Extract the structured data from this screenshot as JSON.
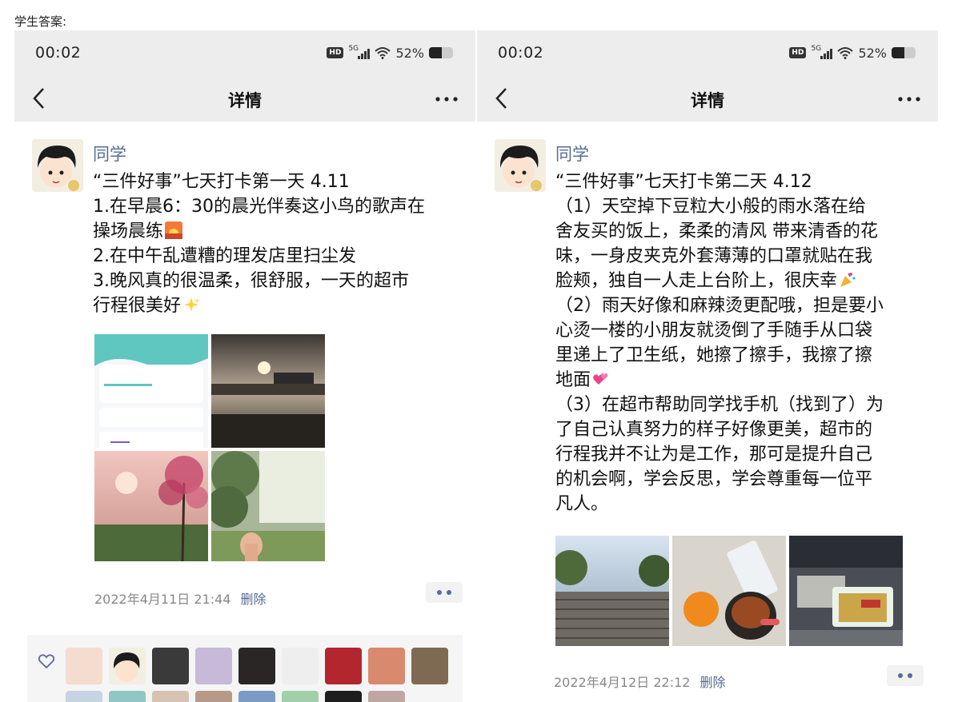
{
  "page_label": "学生答案:",
  "colors": {
    "bar_bg": "#ededed",
    "link": "#576b95",
    "meta": "#888888"
  },
  "posts": [
    {
      "status": {
        "time": "00:02",
        "hd": "HD",
        "network": "5G",
        "battery": "52%",
        "battery_level": 0.52
      },
      "nav": {
        "title": "详情",
        "back_icon": "chevron-left-icon",
        "more_icon": "more-dots-icon"
      },
      "username": "同学",
      "lines": [
        "“三件好事”七天打卡第一天 4.11",
        "1.在早晨6：30的晨光伴奏这小鸟的歌声在",
        "操场晨练",
        "2.在中午乱遭糟的理发店里扫尘发",
        "3.晚风真的很温柔，很舒服，一天的超市",
        "行程很美好"
      ],
      "emojis": [
        "sunrise-emoji",
        "sparkles-emoji"
      ],
      "photos": [
        "running-app-screenshot",
        "sunset-over-field",
        "pink-blossom-sunset",
        "hand-in-sunlit-park"
      ],
      "timestamp": "2022年4月11日 21:44",
      "delete_label": "删除",
      "like_icon": "heart-icon"
    },
    {
      "status": {
        "time": "00:02",
        "hd": "HD",
        "network": "5G",
        "battery": "52%",
        "battery_level": 0.52
      },
      "nav": {
        "title": "详情",
        "back_icon": "chevron-left-icon",
        "more_icon": "more-dots-icon"
      },
      "username": "同学",
      "lines": [
        "“三件好事”七天打卡第二天 4.12",
        "（1）天空掉下豆粒大小般的雨水落在给",
        "舍友买的饭上，柔柔的清风 带来清香的花",
        "味，一身皮夹克外套薄薄的口罩就贴在我",
        "脸颊，独自一人走上台阶上，很庆幸",
        "（2）雨天好像和麻辣烫更配哦，担是要小",
        "心烫一楼的小朋友就烫倒了手随手从口袋",
        "里递上了卫生纸，她擦了擦手，我擦了擦",
        "地面",
        "（3）在超市帮助同学找手机（找到了）为",
        "了自己认真努力的样子好像更美，超市的",
        "行程我并不让为是工作，那可是提升自己",
        "的机会啊，学会反思，学会尊重每一位平",
        "凡人。"
      ],
      "emojis": [
        "party-popper-emoji",
        "hearts-emoji"
      ],
      "photos": [
        "outdoor-stairs",
        "orange-and-meal-bowl",
        "food-box-on-table"
      ],
      "timestamp": "2022年4月12日 22:12",
      "delete_label": "删除"
    }
  ]
}
